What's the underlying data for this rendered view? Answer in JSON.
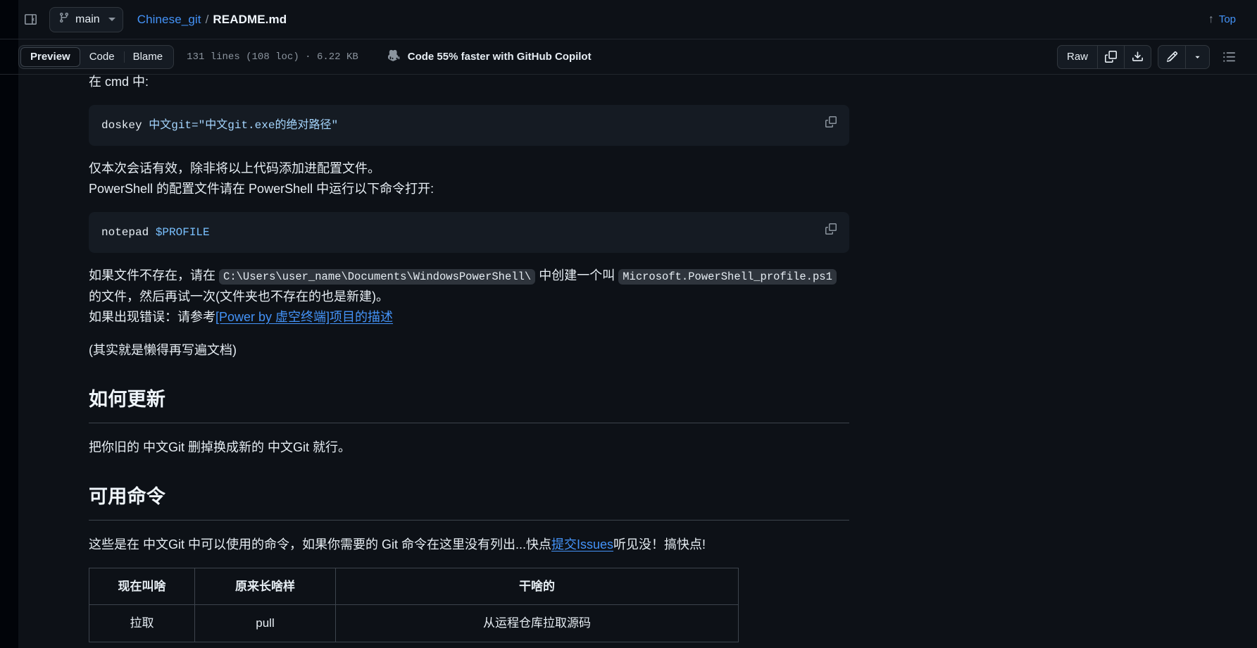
{
  "topbar": {
    "sidebar_toggle_title": "Toggle sidebar",
    "branch": "main",
    "repo": "Chinese_git",
    "separator": "/",
    "file": "README.md",
    "top_label": "Top",
    "top_arrow": "↑"
  },
  "toolbar": {
    "tabs": [
      {
        "label": "Preview",
        "active": true
      },
      {
        "label": "Code",
        "active": false
      },
      {
        "label": "Blame",
        "active": false
      }
    ],
    "file_meta": "131 lines (108 loc) · 6.22 KB",
    "copilot_text": "Code 55% faster with GitHub Copilot",
    "raw_label": "Raw",
    "copy_title": "Copy raw content",
    "download_title": "Download raw file",
    "edit_title": "Edit file",
    "edit_menu_title": "More edit options",
    "outline_title": "Outline"
  },
  "document": {
    "p_cmd": "在 cmd 中:",
    "code1": {
      "command": "doskey ",
      "assign": "中文git=",
      "string": "\"中文git.exe的绝对路径\""
    },
    "p_session_line1": "仅本次会话有效，除非将以上代码添加进配置文件。",
    "p_session_line2": "PowerShell 的配置文件请在 PowerShell 中运行以下命令打开:",
    "code2": {
      "command": "notepad ",
      "variable": "$PROFILE"
    },
    "p_profile": {
      "part1": "如果文件不存在，请在",
      "code1": "C:\\Users\\user_name\\Documents\\WindowsPowerShell\\",
      "part2": "中创建一个叫",
      "code2": "Microsoft.PowerShell_profile.ps1",
      "part3": "的文件，然后再试一次(文件夹也不存在的也是新建)。"
    },
    "p_error": {
      "prefix": "如果出现错误：请参考",
      "link": "[Power by 虚空终端]项目的描述"
    },
    "p_lazy": "(其实就是懒得再写遍文档)",
    "h2_update": "如何更新",
    "p_update": "把你旧的 中文Git 删掉换成新的 中文Git 就行。",
    "h2_commands": "可用命令",
    "p_commands": {
      "prefix": "这些是在 中文Git 中可以使用的命令，如果你需要的 Git 命令在这里没有列出...快点",
      "link": "提交Issues",
      "suffix": "听见没！搞快点!"
    },
    "table": {
      "headers": [
        "现在叫啥",
        "原来长啥样",
        "干啥的"
      ],
      "rows": [
        [
          "拉取",
          "pull",
          "从运程仓库拉取源码"
        ]
      ]
    }
  }
}
